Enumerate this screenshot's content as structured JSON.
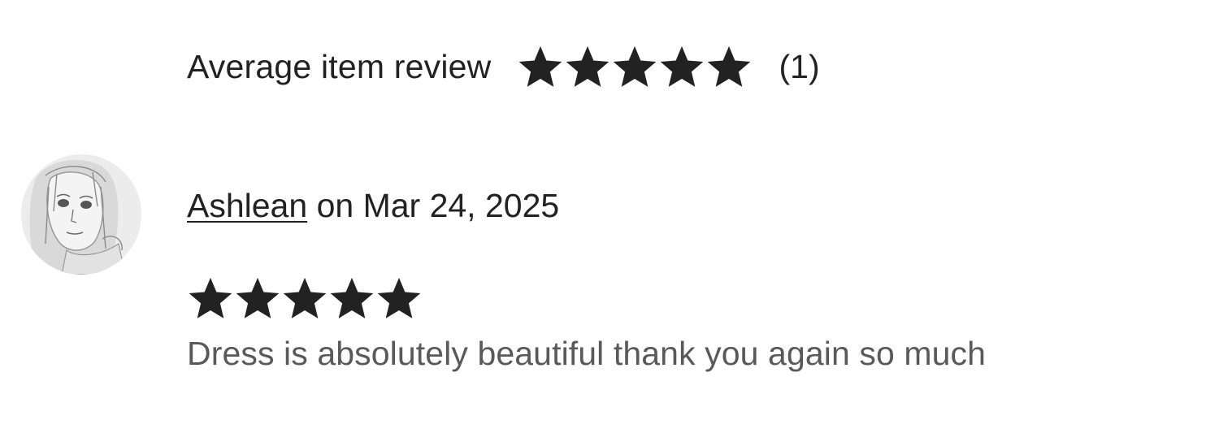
{
  "summary": {
    "label": "Average item review",
    "rating": 5,
    "max_rating": 5,
    "count_text": "(1)"
  },
  "review": {
    "reviewer_name": "Ashlean",
    "date_text": "on Mar 24, 2025",
    "rating": 5,
    "max_rating": 5,
    "body": "Dress is absolutely beautiful thank you again so much"
  },
  "icons": {
    "star": "star-icon",
    "avatar": "reviewer-avatar"
  },
  "colors": {
    "text": "#222222",
    "secondary_text": "#595959",
    "star": "#222222"
  }
}
